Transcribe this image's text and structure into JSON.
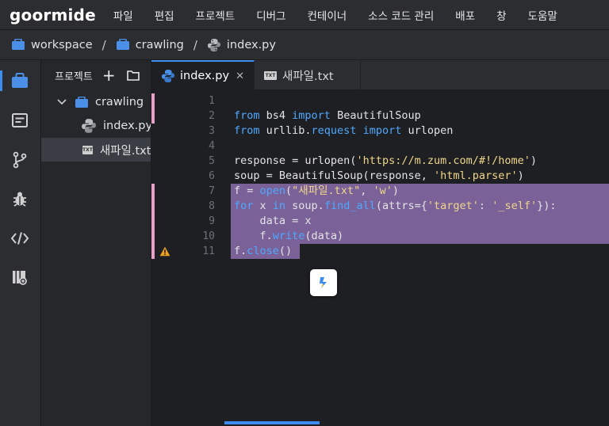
{
  "app": {
    "logo": "goormide"
  },
  "menu": [
    "파일",
    "편집",
    "프로젝트",
    "디버그",
    "컨테이너",
    "소스 코드 관리",
    "배포",
    "창",
    "도움말"
  ],
  "breadcrumb": [
    "workspace",
    "crawling",
    "index.py"
  ],
  "explorer": {
    "title": "프로젝트",
    "add": "+",
    "tree": [
      {
        "label": "crawling",
        "type": "folder",
        "expanded": true
      },
      {
        "label": "index.py",
        "type": "python"
      },
      {
        "label": "새파일.txt",
        "type": "txt",
        "selected": true
      }
    ]
  },
  "tabs": [
    {
      "label": "index.py",
      "active": true,
      "close": "✕"
    },
    {
      "label": "새파일.txt",
      "active": false,
      "badge": "TXT"
    }
  ],
  "editor": {
    "lines": [
      "",
      "from bs4 import BeautifulSoup",
      "from urllib.request import urlopen",
      "",
      "response = urlopen('https://m.zum.com/#!/home')",
      "soup = BeautifulSoup(response, 'html.parser')",
      "f = open(\"새파일.txt\", 'w')",
      "for x in soup.find_all(attrs={'target': '_self'}):",
      "    data = x",
      "    f.write(data)",
      "f.close()"
    ],
    "warning_line": 11,
    "modified_lines": [
      1,
      2,
      7,
      8,
      9,
      10,
      11
    ],
    "selected_lines": [
      7,
      8,
      9,
      10,
      11
    ]
  },
  "colors": {
    "accent": "#3d8cf0",
    "selection": "#7a6299",
    "keyword": "#4fa8ff",
    "string": "#f0d68a"
  },
  "icons": [
    "project-icon",
    "outline-icon",
    "git-branch-icon",
    "debug-bug-icon",
    "code-tag-icon",
    "library-icon",
    "folder-icon",
    "python-icon",
    "warning-icon"
  ]
}
